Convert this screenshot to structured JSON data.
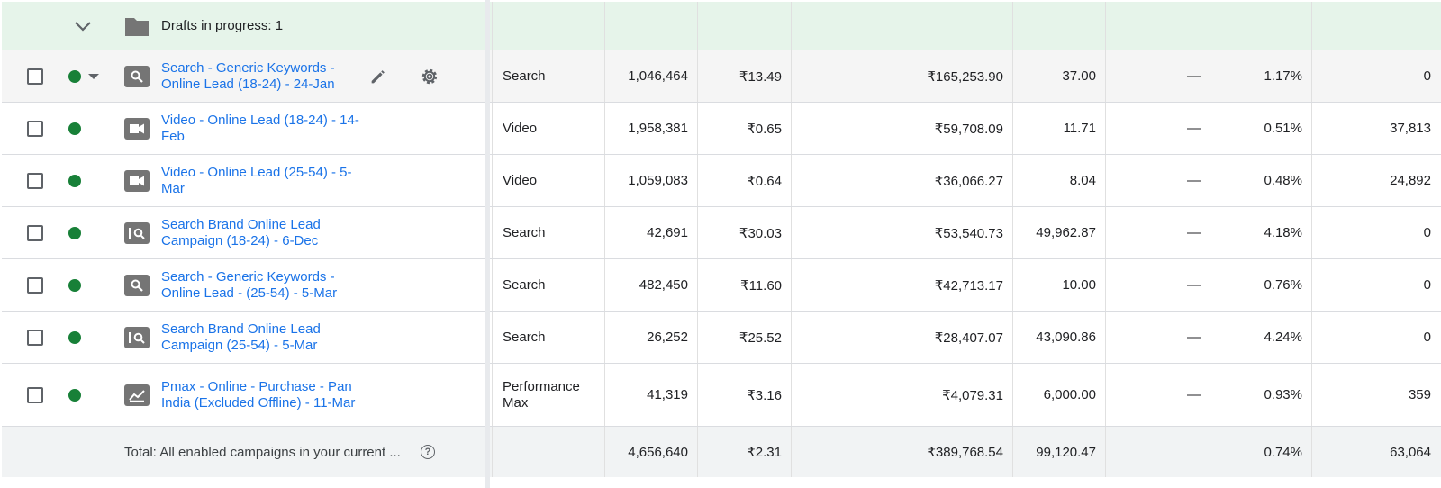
{
  "drafts": {
    "label": "Drafts in progress: 1"
  },
  "campaigns": [
    {
      "name": "Search - Generic Keywords - Online Lead (18-24) - 24-Jan",
      "type": "Search",
      "icon": "search-campaign-icon",
      "impr": "1,046,464",
      "avg_cpc": "₹13.49",
      "cost": "₹165,253.90",
      "c4": "37.00",
      "c5": "—",
      "rate": "1.17%",
      "c7": "0"
    },
    {
      "name": "Video - Online Lead (18-24) - 14-Feb",
      "type": "Video",
      "icon": "video-campaign-icon",
      "impr": "1,958,381",
      "avg_cpc": "₹0.65",
      "cost": "₹59,708.09",
      "c4": "11.71",
      "c5": "—",
      "rate": "0.51%",
      "c7": "37,813"
    },
    {
      "name": "Video - Online Lead (25-54) - 5-Mar",
      "type": "Video",
      "icon": "video-campaign-icon",
      "impr": "1,059,083",
      "avg_cpc": "₹0.64",
      "cost": "₹36,066.27",
      "c4": "8.04",
      "c5": "—",
      "rate": "0.48%",
      "c7": "24,892"
    },
    {
      "name": "Search Brand Online Lead Campaign (18-24) - 6-Dec",
      "type": "Search",
      "icon": "brand-search-campaign-icon",
      "impr": "42,691",
      "avg_cpc": "₹30.03",
      "cost": "₹53,540.73",
      "c4": "49,962.87",
      "c5": "—",
      "rate": "4.18%",
      "c7": "0"
    },
    {
      "name": "Search - Generic Keywords - Online Lead - (25-54) - 5-Mar",
      "type": "Search",
      "icon": "search-campaign-icon",
      "impr": "482,450",
      "avg_cpc": "₹11.60",
      "cost": "₹42,713.17",
      "c4": "10.00",
      "c5": "—",
      "rate": "0.76%",
      "c7": "0"
    },
    {
      "name": "Search Brand Online Lead Campaign (25-54) - 5-Mar",
      "type": "Search",
      "icon": "brand-search-campaign-icon",
      "impr": "26,252",
      "avg_cpc": "₹25.52",
      "cost": "₹28,407.07",
      "c4": "43,090.86",
      "c5": "—",
      "rate": "4.24%",
      "c7": "0"
    },
    {
      "name": "Pmax - Online - Purchase - Pan India (Excluded Offline) - 11-Mar",
      "type": "Performance Max",
      "icon": "performance-max-campaign-icon",
      "impr": "41,319",
      "avg_cpc": "₹3.16",
      "cost": "₹4,079.31",
      "c4": "6,000.00",
      "c5": "—",
      "rate": "0.93%",
      "c7": "359"
    }
  ],
  "total": {
    "label": "Total: All enabled campaigns in your current ...",
    "help_glyph": "?",
    "impr": "4,656,640",
    "avg_cpc": "₹2.31",
    "cost": "₹389,768.54",
    "c4": "99,120.47",
    "rate": "0.74%",
    "c7": "63,064"
  },
  "colors": {
    "link": "#1a73e8",
    "status_enabled": "#188038",
    "drafts_bg": "#e6f4ea",
    "hover_row_bg": "#f5f5f5"
  }
}
